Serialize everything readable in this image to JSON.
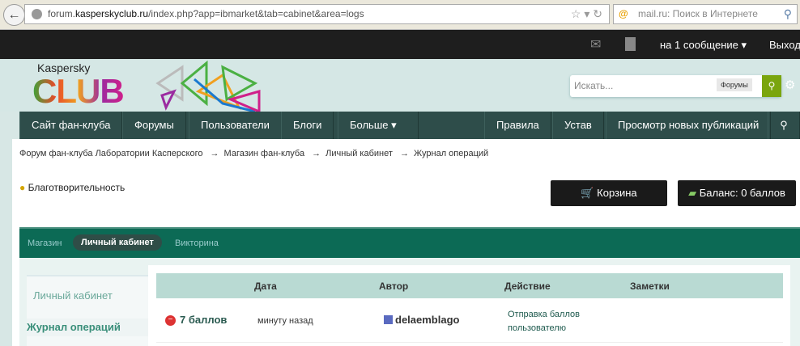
{
  "browser": {
    "url_pre": "forum.",
    "url_domain": "kasperskyclub.ru",
    "url_post": "/index.php?app=ibmarket&tab=cabinet&area=logs",
    "search_placeholder": "mail.ru: Поиск в Интернете"
  },
  "topbar": {
    "messages": "на 1 сообщение",
    "logout": "Выход"
  },
  "logo": {
    "brand": "Kaspersky",
    "club": "CLUB"
  },
  "search": {
    "placeholder": "Искать...",
    "scope": "Форумы"
  },
  "nav": {
    "left": [
      "Сайт фан-клуба",
      "Форумы",
      "Пользователи",
      "Блоги",
      "Больше"
    ],
    "right": [
      "Правила",
      "Устав",
      "Просмотр новых публикаций"
    ]
  },
  "breadcrumb": [
    "Форум фан-клуба Лаборатории Касперского",
    "Магазин фан-клуба",
    "Личный кабинет",
    "Журнал операций"
  ],
  "charity": "Благотворительность",
  "cart": "Корзина",
  "balance": "Баланс: 0 баллов",
  "tabs": [
    "Магазин",
    "Личный кабинет",
    "Викторина"
  ],
  "sidebar": [
    "Личный кабинет",
    "Журнал операций"
  ],
  "table": {
    "headers": [
      "Дата",
      "Автор",
      "Действие",
      "Заметки"
    ],
    "rows": [
      {
        "amount": "7 баллов",
        "date": "минуту назад",
        "author": "delaemblago",
        "action1": "Отправка баллов",
        "action2": "пользователю"
      }
    ]
  }
}
